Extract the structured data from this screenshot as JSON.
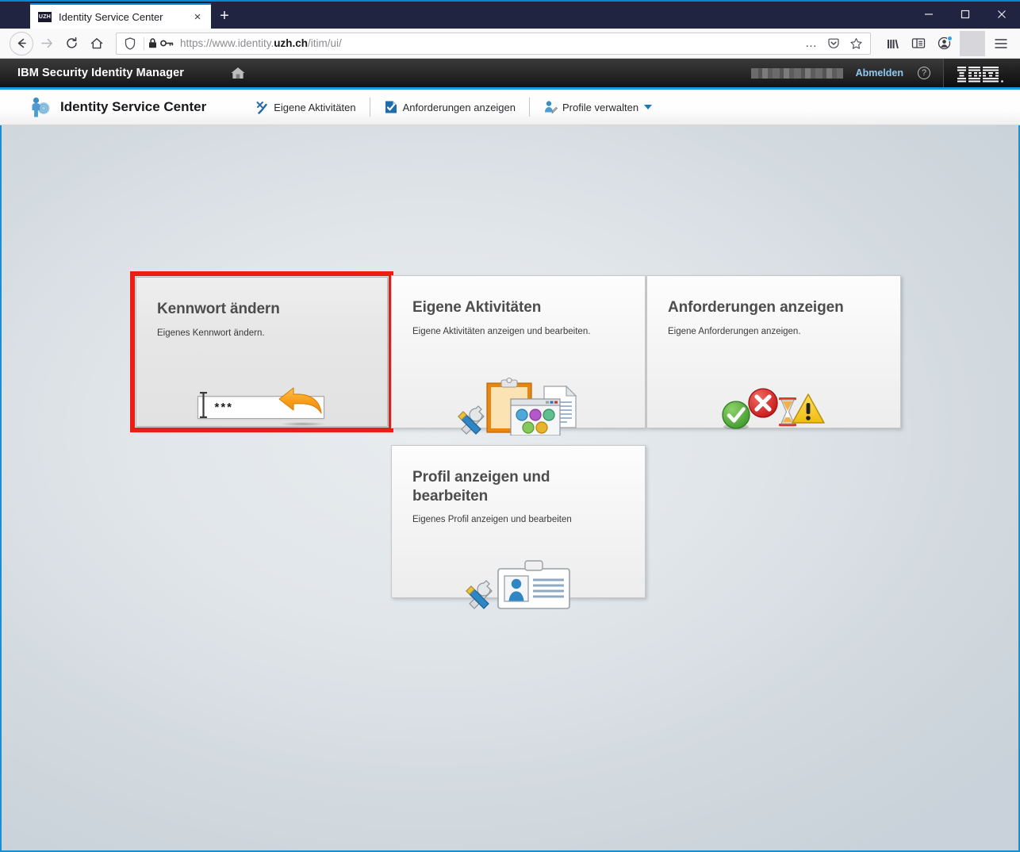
{
  "browser": {
    "tab": {
      "title": "Identity Service Center",
      "favicon_label": "UZH",
      "close_label": "×"
    },
    "newtab_label": "+",
    "window_controls": {
      "minimize": "minimize-icon",
      "maximize": "maximize-icon",
      "close": "close-icon"
    },
    "nav": {
      "back": "back-icon",
      "forward": "forward-icon",
      "reload": "reload-icon",
      "home": "home-icon",
      "url_prefix": "https://www.identity.",
      "url_domain": "uzh.ch",
      "url_suffix": "/itim/ui/",
      "url_full": "https://www.identity.uzh.ch/itim/ui/",
      "page_actions": "…",
      "icons": [
        "tracking-shield-icon",
        "lock-icon",
        "key-icon",
        "page-actions-icon",
        "pocket-icon",
        "bookmark-star-icon",
        "library-icon",
        "sidebar-icon",
        "account-icon",
        "menu-hamburger-icon"
      ]
    }
  },
  "ibm_header": {
    "product_title": "IBM Security Identity Manager",
    "home_icon": "home-icon",
    "username_redacted": "",
    "logout_label": "Abmelden",
    "help_icon_label": "?",
    "logo_text": "IBM"
  },
  "isc_nav": {
    "brand": "Identity Service Center",
    "brand_icon": "user-fingerprint-icon",
    "items": [
      {
        "label": "Eigene Aktivitäten",
        "icon": "tools-check-icon",
        "has_caret": false
      },
      {
        "label": "Anforderungen anzeigen",
        "icon": "document-check-icon",
        "has_caret": false
      },
      {
        "label": "Profile verwalten",
        "icon": "person-edit-icon",
        "has_caret": true
      }
    ]
  },
  "cards": [
    {
      "id": "kennwort-aendern",
      "title": "Kennwort ändern",
      "subtitle": "Eigenes Kennwort ändern.",
      "art": "password-field-arrow",
      "highlighted": true,
      "active": true,
      "password_value": "***"
    },
    {
      "id": "eigene-aktivitaeten",
      "title": "Eigene Aktivitäten",
      "subtitle": "Eigene Aktivitäten anzeigen und bearbeiten.",
      "art": "tools-clipboard-dialog-document",
      "highlighted": false,
      "active": false
    },
    {
      "id": "anforderungen-anzeigen",
      "title": "Anforderungen anzeigen",
      "subtitle": "Eigene Anforderungen anzeigen.",
      "art": "status-check-error-pending-warning",
      "highlighted": false,
      "active": false
    },
    {
      "id": "profil-anzeigen-bearbeiten",
      "title": "Profil anzeigen und bearbeiten",
      "subtitle": "Eigenes Profil anzeigen und bearbeiten",
      "art": "tools-idcard",
      "highlighted": false,
      "active": false
    }
  ],
  "colors": {
    "titlebar": "#212440",
    "accent_blue": "#0a84d8",
    "isc_top_rule": "#1a9ddb",
    "content_border": "#1a8fd0",
    "highlight_red": "#ee1c15",
    "link_blue": "#8fc8f0",
    "card_title": "#4d4d4d"
  }
}
